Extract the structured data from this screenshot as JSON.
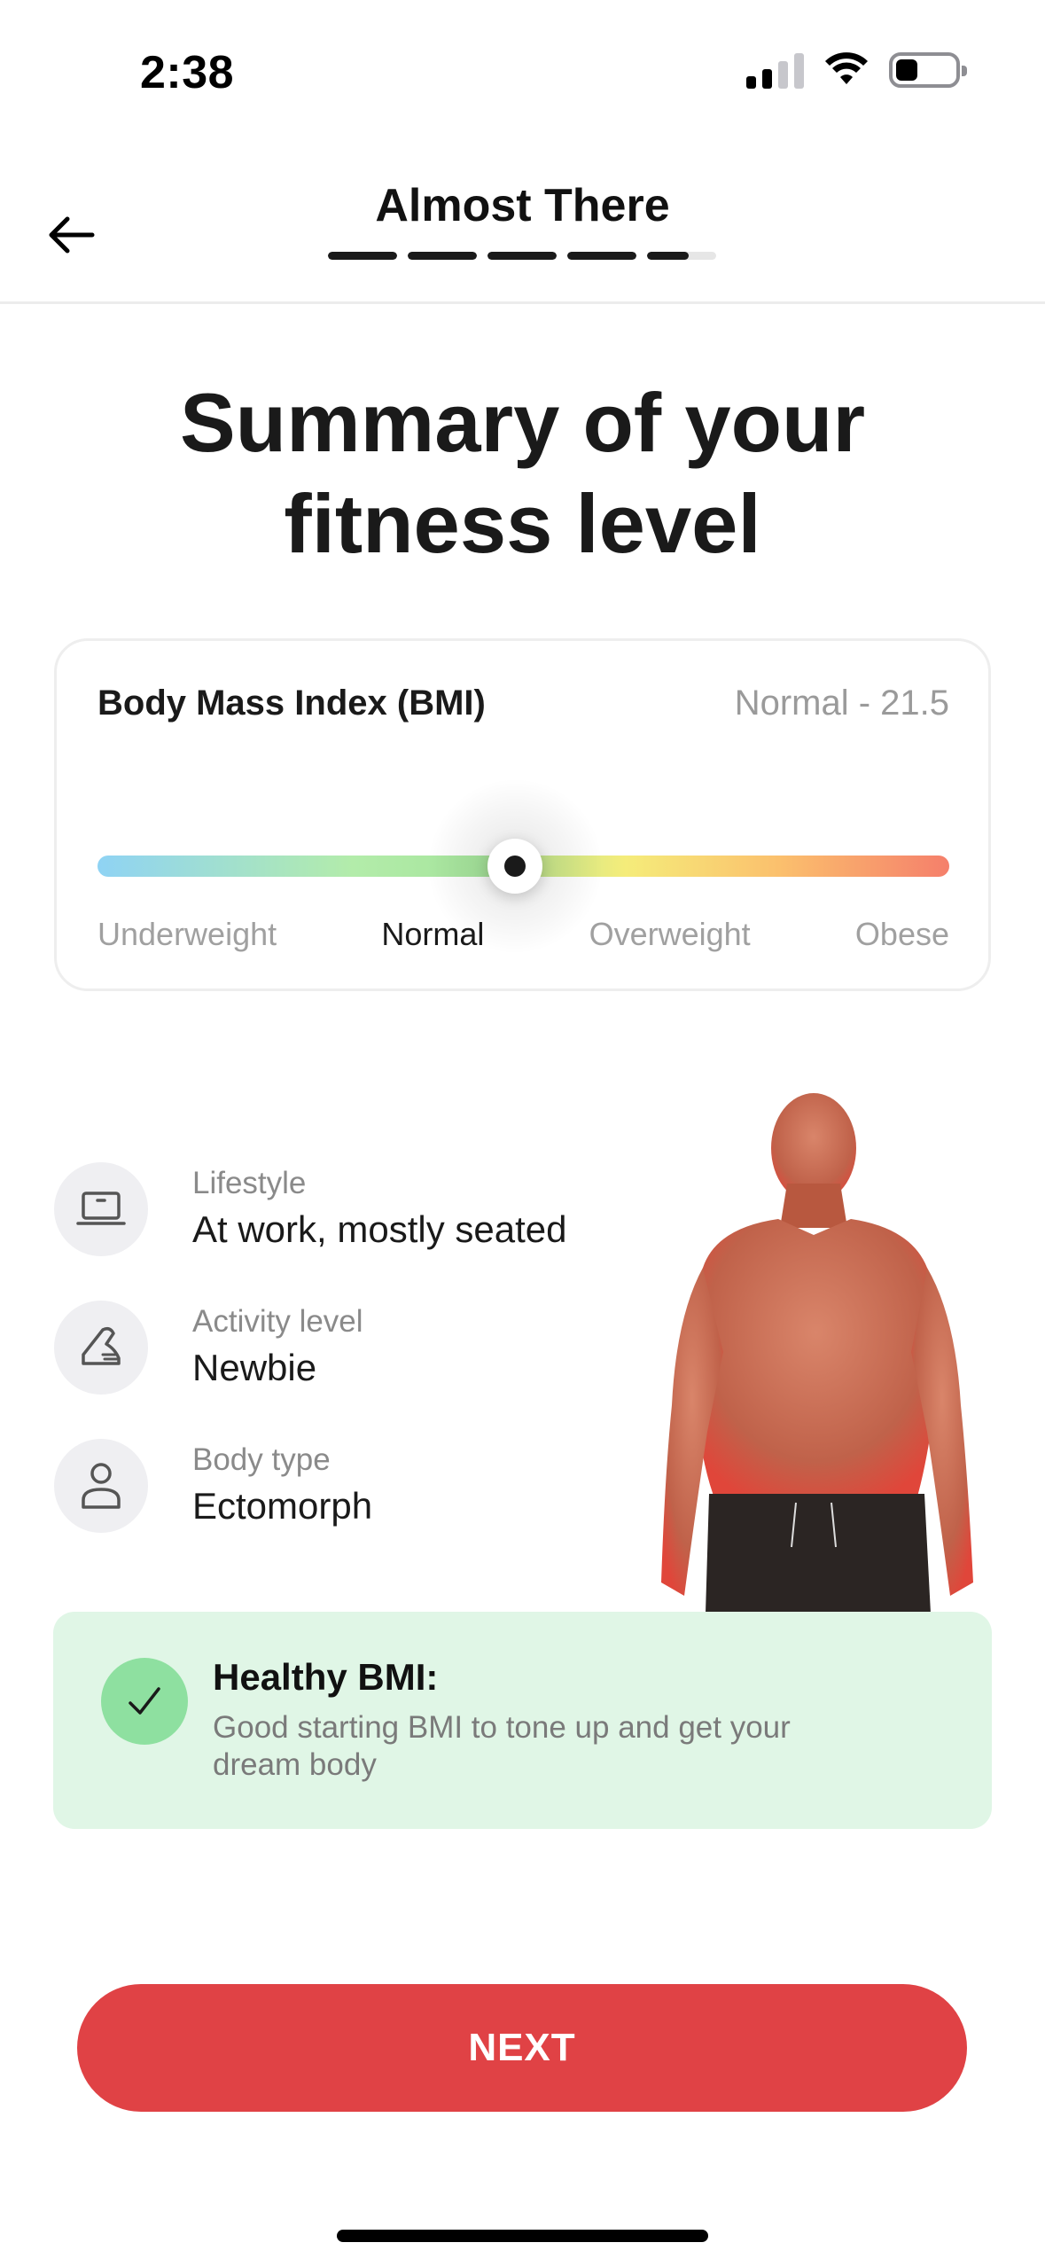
{
  "status_bar": {
    "time": "2:38",
    "icons": [
      "signal-icon",
      "wifi-icon",
      "battery-icon"
    ]
  },
  "header": {
    "title": "Almost There",
    "back_icon": "arrow-left-icon",
    "progress": {
      "total_steps": 5,
      "completed_fraction": 0.92
    }
  },
  "page_title": "Summary of your fitness level",
  "bmi": {
    "label": "Body Mass Index (BMI)",
    "value_text": "Normal - 21.5",
    "position_fraction": 0.49,
    "scale": [
      "Underweight",
      "Normal",
      "Overweight",
      "Obese"
    ],
    "active_index": 1
  },
  "info": [
    {
      "icon": "laptop-icon",
      "label": "Lifestyle",
      "value": "At work, mostly seated"
    },
    {
      "icon": "sneaker-icon",
      "label": "Activity level",
      "value": "Newbie"
    },
    {
      "icon": "person-icon",
      "label": "Body type",
      "value": "Ectomorph"
    }
  ],
  "health_note": {
    "icon": "check-icon",
    "title": "Healthy BMI:",
    "description": "Good starting BMI to tone up and get your dream body"
  },
  "next_button": {
    "label": "NEXT"
  },
  "colors": {
    "accent": "#E04245",
    "success_bg": "#E0F6E6",
    "success_icon": "#8EE0A0",
    "muted_text": "#9A9A9A"
  }
}
